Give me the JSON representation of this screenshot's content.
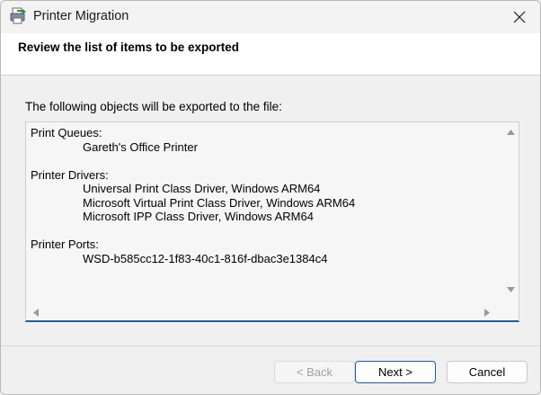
{
  "window": {
    "title": "Printer Migration",
    "icon": "printer-migration-icon"
  },
  "header": {
    "title": "Review the list of items to be exported"
  },
  "main": {
    "intro": "The following objects will be exported to the file:",
    "groups": [
      {
        "label": "Print Queues:",
        "items": [
          "Gareth's Office Printer"
        ]
      },
      {
        "label": "Printer Drivers:",
        "items": [
          "Universal Print Class Driver, Windows ARM64",
          "Microsoft Virtual Print Class Driver, Windows ARM64",
          "Microsoft IPP Class Driver, Windows ARM64"
        ]
      },
      {
        "label": "Printer Ports:",
        "items": [
          "WSD-b585cc12-1f83-40c1-816f-dbac3e1384c4"
        ]
      }
    ]
  },
  "buttons": {
    "back": "< Back",
    "next": "Next >",
    "cancel": "Cancel"
  },
  "colors": {
    "accent": "#1e5ba8",
    "window_bg": "#f0f0f0",
    "header_bg": "#ffffff"
  }
}
